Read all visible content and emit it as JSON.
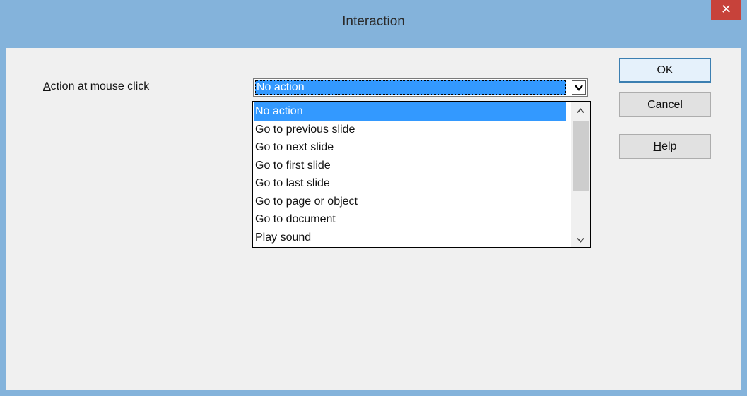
{
  "window": {
    "title": "Interaction",
    "close_glyph": "✕"
  },
  "form": {
    "action_label_mnemonic": "A",
    "action_label_rest": "ction at mouse click",
    "combo_value": "No action"
  },
  "dropdown": {
    "items": [
      {
        "label": "No action",
        "selected": true
      },
      {
        "label": "Go to previous slide",
        "selected": false
      },
      {
        "label": "Go to next slide",
        "selected": false
      },
      {
        "label": "Go to first slide",
        "selected": false
      },
      {
        "label": "Go to last slide",
        "selected": false
      },
      {
        "label": "Go to page or object",
        "selected": false
      },
      {
        "label": "Go to document",
        "selected": false
      },
      {
        "label": "Play sound",
        "selected": false
      }
    ]
  },
  "buttons": {
    "ok": "OK",
    "cancel": "Cancel",
    "help_mnemonic": "H",
    "help_rest": "elp"
  },
  "colors": {
    "titlebar": "#84b3db",
    "close": "#c7423a",
    "selection": "#3399ff",
    "dialog_bg": "#f0f0f0"
  },
  "icons": {
    "close": "close-icon",
    "combo_arrow": "chevron-down-icon",
    "scroll_up": "chevron-up-icon",
    "scroll_down": "chevron-down-icon"
  }
}
